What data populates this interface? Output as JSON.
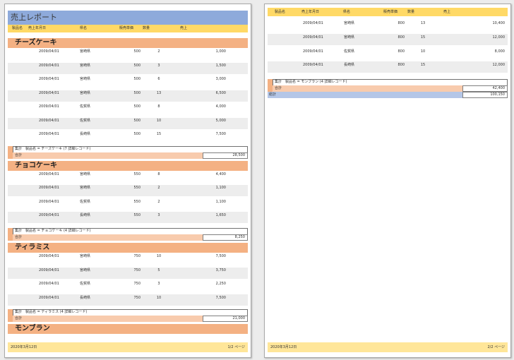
{
  "report_title": "売上レポート",
  "columns": [
    "製品名",
    "売上年月日",
    "県名",
    "販売単価",
    "数量",
    "売上"
  ],
  "summary_prefix": "集計",
  "total_label": "合計",
  "grand_total_label": "総計",
  "page1": {
    "groups": [
      {
        "name": "チーズケーキ",
        "summary": "製品名 = チーズケーキ (7 詳細レコード)",
        "total": "28,500",
        "rows": [
          [
            "2009/04/01",
            "宮崎県",
            "500",
            "2",
            "1,000"
          ],
          [
            "2009/04/01",
            "宮崎県",
            "500",
            "3",
            "1,500"
          ],
          [
            "2009/04/01",
            "宮崎県",
            "500",
            "6",
            "3,000"
          ],
          [
            "2009/04/01",
            "宮崎県",
            "500",
            "13",
            "6,500"
          ],
          [
            "2009/04/01",
            "佐賀県",
            "500",
            "8",
            "4,000"
          ],
          [
            "2009/04/01",
            "佐賀県",
            "500",
            "10",
            "5,000"
          ],
          [
            "2009/04/01",
            "長崎県",
            "500",
            "15",
            "7,500"
          ]
        ]
      },
      {
        "name": "チョコケーキ",
        "summary": "製品名 = チョコケーキ (4 詳細レコード)",
        "total": "8,250",
        "rows": [
          [
            "2009/04/01",
            "宮崎県",
            "550",
            "8",
            "4,400"
          ],
          [
            "2009/04/01",
            "宮崎県",
            "550",
            "2",
            "1,100"
          ],
          [
            "2009/04/01",
            "佐賀県",
            "550",
            "2",
            "1,100"
          ],
          [
            "2009/04/01",
            "長崎県",
            "550",
            "3",
            "1,650"
          ]
        ]
      },
      {
        "name": "ティラミス",
        "summary": "製品名 = ティラミス (4 詳細レコード)",
        "total": "21,000",
        "rows": [
          [
            "2009/04/01",
            "宮崎県",
            "750",
            "10",
            "7,500"
          ],
          [
            "2009/04/01",
            "宮崎県",
            "750",
            "5",
            "3,750"
          ],
          [
            "2009/04/01",
            "佐賀県",
            "750",
            "3",
            "2,250"
          ],
          [
            "2009/04/01",
            "長崎県",
            "750",
            "10",
            "7,500"
          ]
        ]
      }
    ],
    "next_group_name": "モンブラン",
    "footer_date": "2020年3月12日",
    "footer_page": "1/2 ページ"
  },
  "page2": {
    "rows": [
      [
        "2009/04/01",
        "宮崎県",
        "800",
        "13",
        "10,400"
      ],
      [
        "2009/04/01",
        "宮崎県",
        "800",
        "15",
        "12,000"
      ],
      [
        "2009/04/01",
        "佐賀県",
        "800",
        "10",
        "8,000"
      ],
      [
        "2009/04/01",
        "長崎県",
        "800",
        "15",
        "12,000"
      ]
    ],
    "summary": "製品名 = モンブラン (4 詳細レコード)",
    "total": "42,400",
    "grand_total": "100,150",
    "footer_date": "2020年3月12日",
    "footer_page": "2/2 ページ"
  },
  "colors": {
    "title_band": "#8eaadb",
    "column_header": "#ffd966",
    "group_band": "#f4b183",
    "total_band": "#f8cbad",
    "grand_total_band": "#b4c6e7",
    "footer_band": "#ffe699"
  }
}
